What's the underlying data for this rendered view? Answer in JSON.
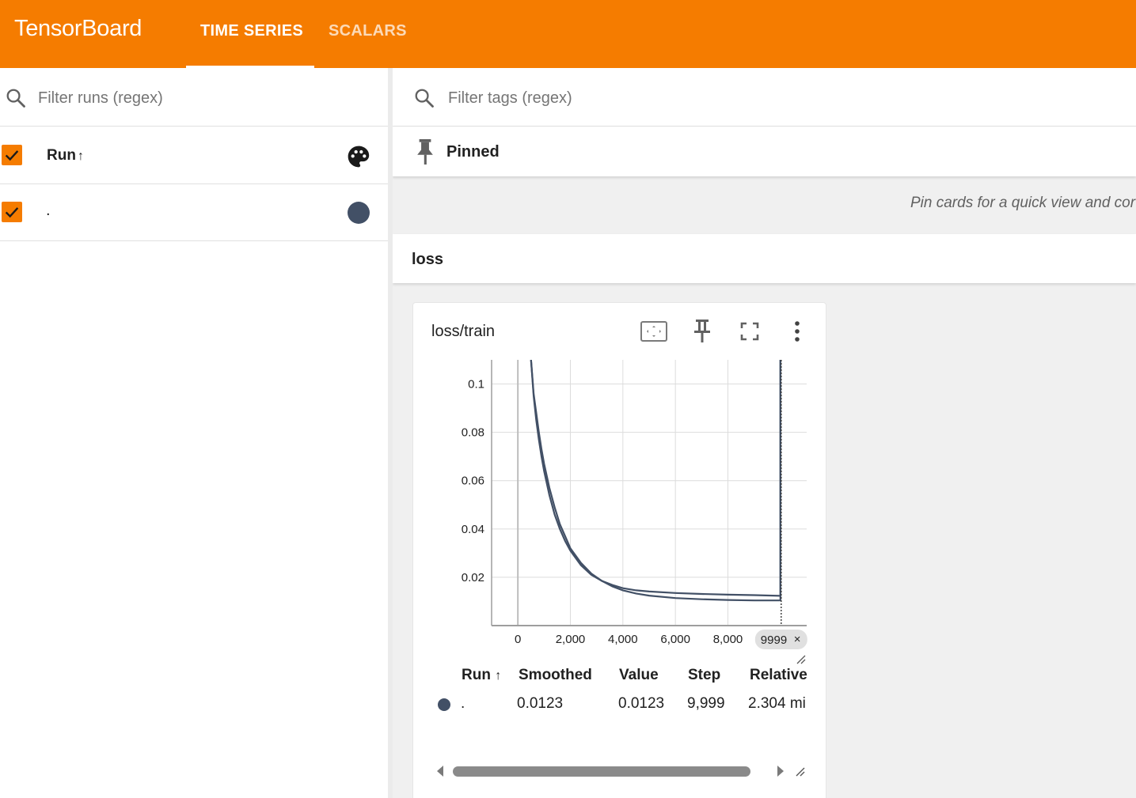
{
  "app": {
    "title": "TensorBoard",
    "tabs": [
      {
        "label": "TIME SERIES",
        "active": true
      },
      {
        "label": "SCALARS",
        "active": false
      }
    ],
    "accent_color": "#f57c00"
  },
  "sidebar": {
    "filter_runs_placeholder": "Filter runs (regex)",
    "run_header": {
      "label": "Run",
      "sort_icon": "arrow-up-icon",
      "checked": true,
      "palette_icon": "palette-icon"
    },
    "runs": [
      {
        "name": ".",
        "checked": true,
        "color": "#425066"
      }
    ]
  },
  "main": {
    "filter_tags_placeholder": "Filter tags (regex)",
    "pinned": {
      "title": "Pinned",
      "icon": "pin-icon",
      "hint": "Pin cards for a quick view and cor"
    },
    "group": {
      "title": "loss"
    },
    "card": {
      "title": "loss/train",
      "tools": [
        "fit-domain-icon",
        "pin-icon",
        "fullscreen-icon",
        "more-vert-icon"
      ],
      "step_chip": "9999",
      "table": {
        "headers": {
          "run": "Run",
          "smoothed": "Smoothed",
          "value": "Value",
          "step": "Step",
          "relative": "Relative"
        },
        "rows": [
          {
            "run": ".",
            "color": "#425066",
            "smoothed": "0.0123",
            "value": "0.0123",
            "step": "9,999",
            "relative": "2.304 mi"
          }
        ]
      }
    }
  },
  "chart_data": {
    "type": "line",
    "title": "loss/train",
    "xlabel": "",
    "ylabel": "",
    "xlim": [
      -1000,
      11000
    ],
    "ylim": [
      0,
      0.11
    ],
    "x_ticks": [
      0,
      2000,
      4000,
      6000,
      8000
    ],
    "x_tick_labels": [
      "0",
      "2,000",
      "4,000",
      "6,000",
      "8,000"
    ],
    "y_ticks": [
      0.02,
      0.04,
      0.06,
      0.08,
      0.1
    ],
    "y_tick_labels": [
      "0.02",
      "0.04",
      "0.06",
      "0.08",
      "0.1"
    ],
    "grid": true,
    "series": [
      {
        "color": "#425066",
        "x": [
          500,
          600,
          700,
          800,
          900,
          1000,
          1200,
          1400,
          1600,
          1800,
          2000,
          2400,
          2800,
          3200,
          3600,
          4000,
          4500,
          5000,
          6000,
          7000,
          8000,
          9000,
          9999
        ],
        "values": [
          0.11,
          0.095,
          0.085,
          0.077,
          0.07,
          0.064,
          0.054,
          0.046,
          0.04,
          0.035,
          0.031,
          0.025,
          0.021,
          0.0185,
          0.0168,
          0.0155,
          0.0146,
          0.0141,
          0.0135,
          0.0131,
          0.0128,
          0.0126,
          0.0123
        ]
      },
      {
        "color": "#425066",
        "x": [
          500,
          600,
          700,
          800,
          900,
          1000,
          1200,
          1400,
          1600,
          1800,
          2000,
          2400,
          2800,
          3200,
          3600,
          4000,
          4500,
          5000,
          6000,
          7000,
          8000,
          9000,
          9999
        ],
        "values": [
          0.11,
          0.096,
          0.088,
          0.08,
          0.073,
          0.067,
          0.057,
          0.049,
          0.042,
          0.037,
          0.032,
          0.026,
          0.0215,
          0.0185,
          0.0162,
          0.0146,
          0.0133,
          0.0124,
          0.0114,
          0.0109,
          0.0106,
          0.0104,
          0.0104
        ]
      }
    ],
    "annotations": [
      {
        "type": "step-line",
        "x": 9999
      }
    ]
  }
}
